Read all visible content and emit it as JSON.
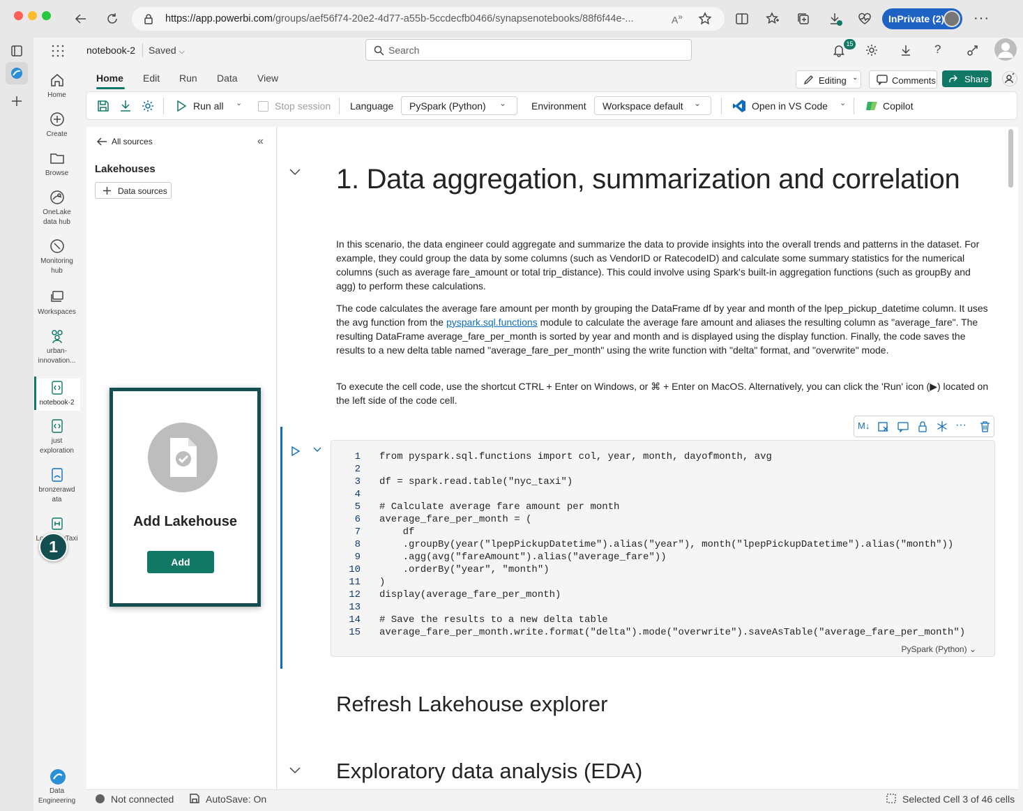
{
  "browser": {
    "url_host": "https://app.powerbi.com",
    "url_rest": "/groups/aef56f74-20e2-4d77-a55b-5ccdecfb0466/synapsenotebooks/88f6f44e-...",
    "inprivate_label": "InPrivate (2)"
  },
  "header": {
    "notebook_name": "notebook-2",
    "save_status": "Saved",
    "search_placeholder": "Search",
    "notification_count": "15"
  },
  "leftnav": [
    {
      "label": "Home",
      "icon": "home-icon"
    },
    {
      "label": "Create",
      "icon": "plus-circle-icon"
    },
    {
      "label": "Browse",
      "icon": "folder-icon"
    },
    {
      "label": "OneLake data hub",
      "icon": "onelake-icon"
    },
    {
      "label": "Monitoring hub",
      "icon": "monitor-icon"
    },
    {
      "label": "Workspaces",
      "icon": "workspaces-icon"
    },
    {
      "label": "urban-innovation...",
      "icon": "group-icon"
    },
    {
      "label": "notebook-2",
      "icon": "notebook-icon"
    },
    {
      "label": "just exploration",
      "icon": "notebook-icon"
    },
    {
      "label": "bronzerawdata",
      "icon": "lakehouse-icon"
    },
    {
      "label": "LoadRawTaxi Data",
      "icon": "pipeline-icon"
    },
    {
      "label": "Data Engineering",
      "icon": "data-engineering-icon"
    }
  ],
  "ribbon": {
    "tabs": [
      "Home",
      "Edit",
      "Run",
      "Data",
      "View"
    ],
    "editing_label": "Editing",
    "comments_label": "Comments",
    "share_label": "Share",
    "run_all_label": "Run all",
    "stop_session_label": "Stop session",
    "language_label": "Language",
    "language_value": "PySpark (Python)",
    "environment_label": "Environment",
    "environment_value": "Workspace default",
    "vscode_label": "Open in VS Code",
    "copilot_label": "Copilot"
  },
  "lakehouse_panel": {
    "back_label": "All sources",
    "title": "Lakehouses",
    "data_sources_label": "Data sources",
    "card_title": "Add Lakehouse",
    "add_button": "Add",
    "step_number": "1"
  },
  "notebook": {
    "heading": "1. Data aggregation, summarization and correlation",
    "para1": "In this scenario, the data engineer could aggregate and summarize the data to provide insights into the overall trends and patterns in the dataset. For example, they could group the data by some columns (such as VendorID or RatecodeID) and calculate some summary statistics for the numerical columns (such as average fare_amount or total trip_distance). This could involve using Spark's built-in aggregation functions (such as groupBy and agg) to perform these calculations.",
    "para2_a": "The code calculates the average fare amount per month by grouping the DataFrame df by year and month of the lpep_pickup_datetime column. It uses the avg function from the ",
    "para2_link": "pyspark.sql.functions",
    "para2_b": " module to calculate the average fare amount and aliases the resulting column as \"average_fare\". The resulting DataFrame average_fare_per_month is sorted by year and month and is displayed using the display function. Finally, the code saves the results to a new delta table named \"average_fare_per_month\" using the write function with \"delta\" format, and \"overwrite\" mode.",
    "para3": "To execute the cell code, use the shortcut CTRL + Enter on Windows, or ⌘ + Enter on MacOS. Alternatively, you can click the 'Run' icon (▶) located on the left side of the code cell.",
    "code_lines": [
      "from pyspark.sql.functions import col, year, month, dayofmonth, avg",
      "",
      "df = spark.read.table(\"nyc_taxi\")",
      "",
      "# Calculate average fare amount per month",
      "average_fare_per_month = (",
      "    df",
      "    .groupBy(year(\"lpepPickupDatetime\").alias(\"year\"), month(\"lpepPickupDatetime\").alias(\"month\"))",
      "    .agg(avg(\"fareAmount\").alias(\"average_fare\"))",
      "    .orderBy(\"year\", \"month\")",
      ")",
      "display(average_fare_per_month)",
      "",
      "# Save the results to a new delta table",
      "average_fare_per_month.write.format(\"delta\").mode(\"overwrite\").saveAsTable(\"average_fare_per_month\")"
    ],
    "cell_language": "PySpark (Python)",
    "heading2": "Refresh Lakehouse explorer",
    "heading3": "Exploratory data analysis (EDA)"
  },
  "statusbar": {
    "connection": "Not connected",
    "autosave": "AutoSave: On",
    "selection": "Selected Cell 3 of 46 cells"
  },
  "colors": {
    "accent": "#117865",
    "link": "#0f6cbd",
    "card_border": "#134e50"
  }
}
